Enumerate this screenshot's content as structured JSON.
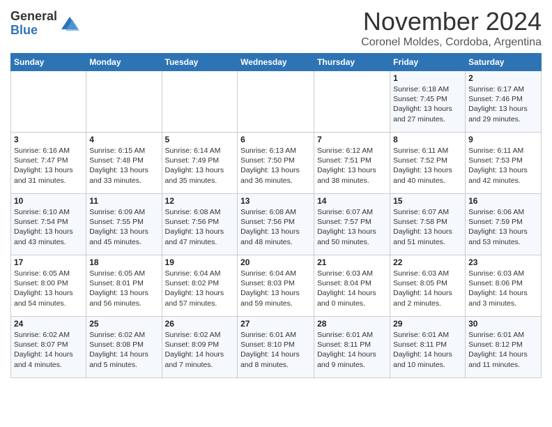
{
  "logo": {
    "general": "General",
    "blue": "Blue"
  },
  "title": "November 2024",
  "subtitle": "Coronel Moldes, Cordoba, Argentina",
  "weekdays": [
    "Sunday",
    "Monday",
    "Tuesday",
    "Wednesday",
    "Thursday",
    "Friday",
    "Saturday"
  ],
  "rows": [
    [
      {
        "day": "",
        "info": ""
      },
      {
        "day": "",
        "info": ""
      },
      {
        "day": "",
        "info": ""
      },
      {
        "day": "",
        "info": ""
      },
      {
        "day": "",
        "info": ""
      },
      {
        "day": "1",
        "info": "Sunrise: 6:18 AM\nSunset: 7:45 PM\nDaylight: 13 hours\nand 27 minutes."
      },
      {
        "day": "2",
        "info": "Sunrise: 6:17 AM\nSunset: 7:46 PM\nDaylight: 13 hours\nand 29 minutes."
      }
    ],
    [
      {
        "day": "3",
        "info": "Sunrise: 6:16 AM\nSunset: 7:47 PM\nDaylight: 13 hours\nand 31 minutes."
      },
      {
        "day": "4",
        "info": "Sunrise: 6:15 AM\nSunset: 7:48 PM\nDaylight: 13 hours\nand 33 minutes."
      },
      {
        "day": "5",
        "info": "Sunrise: 6:14 AM\nSunset: 7:49 PM\nDaylight: 13 hours\nand 35 minutes."
      },
      {
        "day": "6",
        "info": "Sunrise: 6:13 AM\nSunset: 7:50 PM\nDaylight: 13 hours\nand 36 minutes."
      },
      {
        "day": "7",
        "info": "Sunrise: 6:12 AM\nSunset: 7:51 PM\nDaylight: 13 hours\nand 38 minutes."
      },
      {
        "day": "8",
        "info": "Sunrise: 6:11 AM\nSunset: 7:52 PM\nDaylight: 13 hours\nand 40 minutes."
      },
      {
        "day": "9",
        "info": "Sunrise: 6:11 AM\nSunset: 7:53 PM\nDaylight: 13 hours\nand 42 minutes."
      }
    ],
    [
      {
        "day": "10",
        "info": "Sunrise: 6:10 AM\nSunset: 7:54 PM\nDaylight: 13 hours\nand 43 minutes."
      },
      {
        "day": "11",
        "info": "Sunrise: 6:09 AM\nSunset: 7:55 PM\nDaylight: 13 hours\nand 45 minutes."
      },
      {
        "day": "12",
        "info": "Sunrise: 6:08 AM\nSunset: 7:56 PM\nDaylight: 13 hours\nand 47 minutes."
      },
      {
        "day": "13",
        "info": "Sunrise: 6:08 AM\nSunset: 7:56 PM\nDaylight: 13 hours\nand 48 minutes."
      },
      {
        "day": "14",
        "info": "Sunrise: 6:07 AM\nSunset: 7:57 PM\nDaylight: 13 hours\nand 50 minutes."
      },
      {
        "day": "15",
        "info": "Sunrise: 6:07 AM\nSunset: 7:58 PM\nDaylight: 13 hours\nand 51 minutes."
      },
      {
        "day": "16",
        "info": "Sunrise: 6:06 AM\nSunset: 7:59 PM\nDaylight: 13 hours\nand 53 minutes."
      }
    ],
    [
      {
        "day": "17",
        "info": "Sunrise: 6:05 AM\nSunset: 8:00 PM\nDaylight: 13 hours\nand 54 minutes."
      },
      {
        "day": "18",
        "info": "Sunrise: 6:05 AM\nSunset: 8:01 PM\nDaylight: 13 hours\nand 56 minutes."
      },
      {
        "day": "19",
        "info": "Sunrise: 6:04 AM\nSunset: 8:02 PM\nDaylight: 13 hours\nand 57 minutes."
      },
      {
        "day": "20",
        "info": "Sunrise: 6:04 AM\nSunset: 8:03 PM\nDaylight: 13 hours\nand 59 minutes."
      },
      {
        "day": "21",
        "info": "Sunrise: 6:03 AM\nSunset: 8:04 PM\nDaylight: 14 hours\nand 0 minutes."
      },
      {
        "day": "22",
        "info": "Sunrise: 6:03 AM\nSunset: 8:05 PM\nDaylight: 14 hours\nand 2 minutes."
      },
      {
        "day": "23",
        "info": "Sunrise: 6:03 AM\nSunset: 8:06 PM\nDaylight: 14 hours\nand 3 minutes."
      }
    ],
    [
      {
        "day": "24",
        "info": "Sunrise: 6:02 AM\nSunset: 8:07 PM\nDaylight: 14 hours\nand 4 minutes."
      },
      {
        "day": "25",
        "info": "Sunrise: 6:02 AM\nSunset: 8:08 PM\nDaylight: 14 hours\nand 5 minutes."
      },
      {
        "day": "26",
        "info": "Sunrise: 6:02 AM\nSunset: 8:09 PM\nDaylight: 14 hours\nand 7 minutes."
      },
      {
        "day": "27",
        "info": "Sunrise: 6:01 AM\nSunset: 8:10 PM\nDaylight: 14 hours\nand 8 minutes."
      },
      {
        "day": "28",
        "info": "Sunrise: 6:01 AM\nSunset: 8:11 PM\nDaylight: 14 hours\nand 9 minutes."
      },
      {
        "day": "29",
        "info": "Sunrise: 6:01 AM\nSunset: 8:11 PM\nDaylight: 14 hours\nand 10 minutes."
      },
      {
        "day": "30",
        "info": "Sunrise: 6:01 AM\nSunset: 8:12 PM\nDaylight: 14 hours\nand 11 minutes."
      }
    ]
  ]
}
